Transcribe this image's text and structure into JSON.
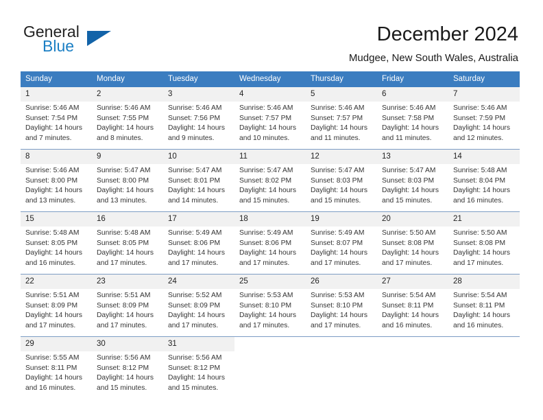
{
  "brand": {
    "name_top": "General",
    "name_bottom": "Blue",
    "accent_color": "#1263a8",
    "text_color": "#222222"
  },
  "header": {
    "title": "December 2024",
    "subtitle": "Mudgee, New South Wales, Australia"
  },
  "theme": {
    "header_bg": "#3b7dc0",
    "daynum_bg": "#f1f1f1",
    "row_divider": "#7c9cc4"
  },
  "labels": {
    "sunrise_prefix": "Sunrise:",
    "sunset_prefix": "Sunset:",
    "daylight_prefix": "Daylight:"
  },
  "weekday_headers": [
    "Sunday",
    "Monday",
    "Tuesday",
    "Wednesday",
    "Thursday",
    "Friday",
    "Saturday"
  ],
  "weeks": [
    [
      {
        "day": "1",
        "sunrise": "Sunrise: 5:46 AM",
        "sunset": "Sunset: 7:54 PM",
        "daylight": "Daylight: 14 hours and 7 minutes."
      },
      {
        "day": "2",
        "sunrise": "Sunrise: 5:46 AM",
        "sunset": "Sunset: 7:55 PM",
        "daylight": "Daylight: 14 hours and 8 minutes."
      },
      {
        "day": "3",
        "sunrise": "Sunrise: 5:46 AM",
        "sunset": "Sunset: 7:56 PM",
        "daylight": "Daylight: 14 hours and 9 minutes."
      },
      {
        "day": "4",
        "sunrise": "Sunrise: 5:46 AM",
        "sunset": "Sunset: 7:57 PM",
        "daylight": "Daylight: 14 hours and 10 minutes."
      },
      {
        "day": "5",
        "sunrise": "Sunrise: 5:46 AM",
        "sunset": "Sunset: 7:57 PM",
        "daylight": "Daylight: 14 hours and 11 minutes."
      },
      {
        "day": "6",
        "sunrise": "Sunrise: 5:46 AM",
        "sunset": "Sunset: 7:58 PM",
        "daylight": "Daylight: 14 hours and 11 minutes."
      },
      {
        "day": "7",
        "sunrise": "Sunrise: 5:46 AM",
        "sunset": "Sunset: 7:59 PM",
        "daylight": "Daylight: 14 hours and 12 minutes."
      }
    ],
    [
      {
        "day": "8",
        "sunrise": "Sunrise: 5:46 AM",
        "sunset": "Sunset: 8:00 PM",
        "daylight": "Daylight: 14 hours and 13 minutes."
      },
      {
        "day": "9",
        "sunrise": "Sunrise: 5:47 AM",
        "sunset": "Sunset: 8:00 PM",
        "daylight": "Daylight: 14 hours and 13 minutes."
      },
      {
        "day": "10",
        "sunrise": "Sunrise: 5:47 AM",
        "sunset": "Sunset: 8:01 PM",
        "daylight": "Daylight: 14 hours and 14 minutes."
      },
      {
        "day": "11",
        "sunrise": "Sunrise: 5:47 AM",
        "sunset": "Sunset: 8:02 PM",
        "daylight": "Daylight: 14 hours and 15 minutes."
      },
      {
        "day": "12",
        "sunrise": "Sunrise: 5:47 AM",
        "sunset": "Sunset: 8:03 PM",
        "daylight": "Daylight: 14 hours and 15 minutes."
      },
      {
        "day": "13",
        "sunrise": "Sunrise: 5:47 AM",
        "sunset": "Sunset: 8:03 PM",
        "daylight": "Daylight: 14 hours and 15 minutes."
      },
      {
        "day": "14",
        "sunrise": "Sunrise: 5:48 AM",
        "sunset": "Sunset: 8:04 PM",
        "daylight": "Daylight: 14 hours and 16 minutes."
      }
    ],
    [
      {
        "day": "15",
        "sunrise": "Sunrise: 5:48 AM",
        "sunset": "Sunset: 8:05 PM",
        "daylight": "Daylight: 14 hours and 16 minutes."
      },
      {
        "day": "16",
        "sunrise": "Sunrise: 5:48 AM",
        "sunset": "Sunset: 8:05 PM",
        "daylight": "Daylight: 14 hours and 17 minutes."
      },
      {
        "day": "17",
        "sunrise": "Sunrise: 5:49 AM",
        "sunset": "Sunset: 8:06 PM",
        "daylight": "Daylight: 14 hours and 17 minutes."
      },
      {
        "day": "18",
        "sunrise": "Sunrise: 5:49 AM",
        "sunset": "Sunset: 8:06 PM",
        "daylight": "Daylight: 14 hours and 17 minutes."
      },
      {
        "day": "19",
        "sunrise": "Sunrise: 5:49 AM",
        "sunset": "Sunset: 8:07 PM",
        "daylight": "Daylight: 14 hours and 17 minutes."
      },
      {
        "day": "20",
        "sunrise": "Sunrise: 5:50 AM",
        "sunset": "Sunset: 8:08 PM",
        "daylight": "Daylight: 14 hours and 17 minutes."
      },
      {
        "day": "21",
        "sunrise": "Sunrise: 5:50 AM",
        "sunset": "Sunset: 8:08 PM",
        "daylight": "Daylight: 14 hours and 17 minutes."
      }
    ],
    [
      {
        "day": "22",
        "sunrise": "Sunrise: 5:51 AM",
        "sunset": "Sunset: 8:09 PM",
        "daylight": "Daylight: 14 hours and 17 minutes."
      },
      {
        "day": "23",
        "sunrise": "Sunrise: 5:51 AM",
        "sunset": "Sunset: 8:09 PM",
        "daylight": "Daylight: 14 hours and 17 minutes."
      },
      {
        "day": "24",
        "sunrise": "Sunrise: 5:52 AM",
        "sunset": "Sunset: 8:09 PM",
        "daylight": "Daylight: 14 hours and 17 minutes."
      },
      {
        "day": "25",
        "sunrise": "Sunrise: 5:53 AM",
        "sunset": "Sunset: 8:10 PM",
        "daylight": "Daylight: 14 hours and 17 minutes."
      },
      {
        "day": "26",
        "sunrise": "Sunrise: 5:53 AM",
        "sunset": "Sunset: 8:10 PM",
        "daylight": "Daylight: 14 hours and 17 minutes."
      },
      {
        "day": "27",
        "sunrise": "Sunrise: 5:54 AM",
        "sunset": "Sunset: 8:11 PM",
        "daylight": "Daylight: 14 hours and 16 minutes."
      },
      {
        "day": "28",
        "sunrise": "Sunrise: 5:54 AM",
        "sunset": "Sunset: 8:11 PM",
        "daylight": "Daylight: 14 hours and 16 minutes."
      }
    ],
    [
      {
        "day": "29",
        "sunrise": "Sunrise: 5:55 AM",
        "sunset": "Sunset: 8:11 PM",
        "daylight": "Daylight: 14 hours and 16 minutes."
      },
      {
        "day": "30",
        "sunrise": "Sunrise: 5:56 AM",
        "sunset": "Sunset: 8:12 PM",
        "daylight": "Daylight: 14 hours and 15 minutes."
      },
      {
        "day": "31",
        "sunrise": "Sunrise: 5:56 AM",
        "sunset": "Sunset: 8:12 PM",
        "daylight": "Daylight: 14 hours and 15 minutes."
      },
      {
        "day": "",
        "sunrise": "",
        "sunset": "",
        "daylight": ""
      },
      {
        "day": "",
        "sunrise": "",
        "sunset": "",
        "daylight": ""
      },
      {
        "day": "",
        "sunrise": "",
        "sunset": "",
        "daylight": ""
      },
      {
        "day": "",
        "sunrise": "",
        "sunset": "",
        "daylight": ""
      }
    ]
  ]
}
